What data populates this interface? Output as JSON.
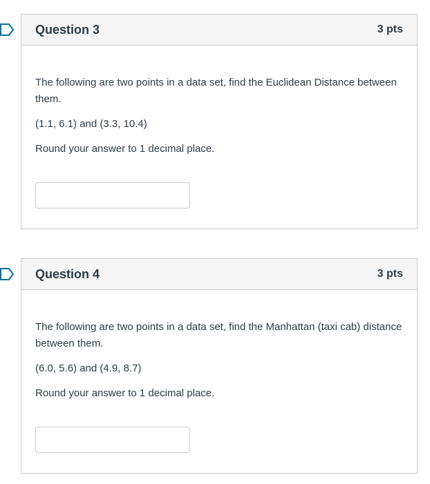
{
  "questions": [
    {
      "title": "Question 3",
      "points": "3 pts",
      "prompt": "The following are two points in a data set, find the Euclidean Distance between them.",
      "points_pair": "(1.1, 6.1) and (3.3, 10.4)",
      "instruction": "Round your answer to 1 decimal place.",
      "answer_value": ""
    },
    {
      "title": "Question 4",
      "points": "3 pts",
      "prompt": "The following are two points in a data set, find the Manhattan (taxi cab) distance between them.",
      "points_pair": "(6.0, 5.6) and (4.9, 8.7)",
      "instruction": "Round your answer to 1 decimal place.",
      "answer_value": ""
    }
  ],
  "colors": {
    "flag": "#0770a3",
    "border": "#c7cdd1",
    "header_bg": "#f5f5f5",
    "text": "#2d3b45"
  },
  "icons": {
    "flag": "bookmark-flag-icon"
  }
}
